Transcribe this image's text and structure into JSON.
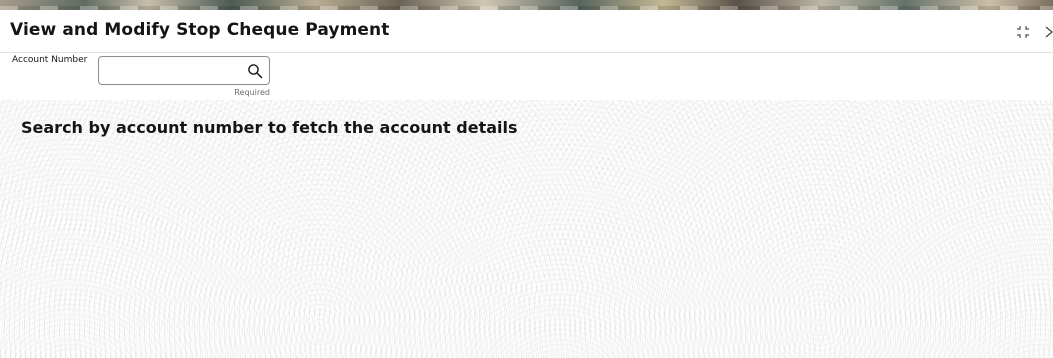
{
  "page": {
    "title": "View and Modify Stop Cheque Payment"
  },
  "window_controls": {
    "restore_icon": "restore-icon",
    "close_icon": "close-icon"
  },
  "form": {
    "account_number": {
      "label": "Account Number",
      "value": "",
      "placeholder": "",
      "helper_text": "Required",
      "search_icon": "search-icon"
    }
  },
  "content": {
    "message": "Search by account number to fetch the account details"
  },
  "colors": {
    "text": "#161513",
    "border": "#8f8c88",
    "divider": "#e4e1dd",
    "helper_text": "#6f6c68"
  }
}
